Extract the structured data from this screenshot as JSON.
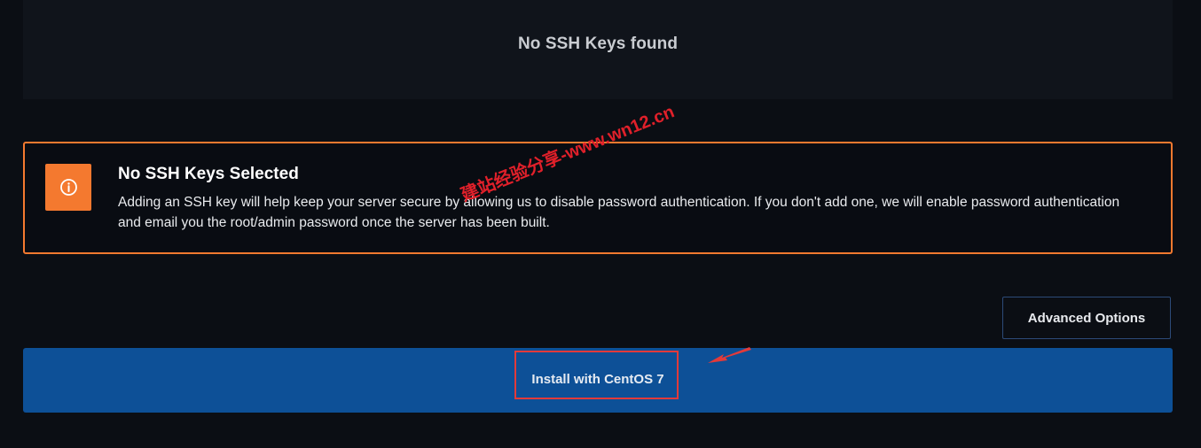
{
  "keys_panel": {
    "empty_message": "No SSH Keys found"
  },
  "alert": {
    "icon": "info-circle-icon",
    "title": "No SSH Keys Selected",
    "body": "Adding an SSH key will help keep your server secure by allowing us to disable password authentication. If you don't add one, we will enable password authentication and email you the root/admin password once the server has been built.",
    "accent_color": "#f4792f"
  },
  "actions": {
    "advanced_options_label": "Advanced Options",
    "install_label": "Install with CentOS 7",
    "install_color": "#0d5097"
  },
  "annotation": {
    "watermark_text": "建站经验分享-www.wn12.cn",
    "highlight_color": "#e23a3a"
  }
}
